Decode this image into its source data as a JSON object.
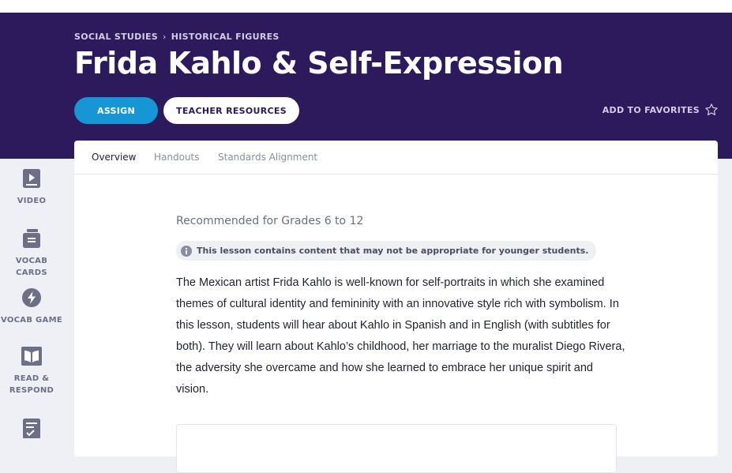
{
  "header": {
    "breadcrumb": [
      "SOCIAL STUDIES",
      "HISTORICAL FIGURES"
    ],
    "breadcrumb_separator": "›",
    "title": "Frida Kahlo & Self-Expression",
    "assign_label": "ASSIGN",
    "teacher_resources_label": "TEACHER RESOURCES",
    "favorites_label": "ADD TO FAVORITES"
  },
  "sidebar": {
    "items": [
      {
        "label": "VIDEO",
        "icon": "video-icon"
      },
      {
        "label": "VOCAB CARDS",
        "icon": "cards-icon"
      },
      {
        "label": "VOCAB GAME",
        "icon": "bolt-icon"
      },
      {
        "label": "READ & RESPOND",
        "icon": "book-icon"
      },
      {
        "label": "",
        "icon": "checklist-icon"
      }
    ]
  },
  "tabs": [
    {
      "label": "Overview",
      "active": true
    },
    {
      "label": "Handouts",
      "active": false
    },
    {
      "label": "Standards Alignment",
      "active": false
    }
  ],
  "content": {
    "grades": "Recommended for Grades 6 to 12",
    "notice": "This lesson contains content that may not be appropriate for younger students.",
    "description": "The Mexican artist Frida Kahlo is well-known for self-portraits in which she examined themes of cultural identity and femininity with an innovative style rich with symbolism. In this lesson, students will hear about Kahlo in Spanish and in English (with subtitles for both). They will learn about Kahlo’s childhood, her marriage to the muralist Diego Rivera, the adversity she overcame and how she learned to embrace her unique spirit and vision."
  },
  "colors": {
    "hero_bg": "#2c1a5c",
    "assign_bg": "#1796d6",
    "page_bg": "#eef0f6",
    "sidebar_icon": "#6c6f86"
  }
}
